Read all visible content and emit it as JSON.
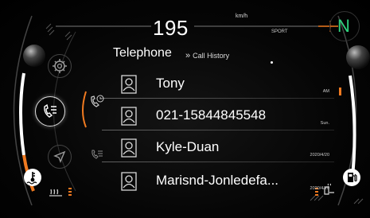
{
  "header": {
    "speed": "195",
    "speed_unit": "km/h",
    "drive_mode": "SPORT",
    "gear": "N"
  },
  "page": {
    "title": "Telephone",
    "breadcrumb": "Call History"
  },
  "calls": [
    {
      "name": "Tony",
      "meta": "AM"
    },
    {
      "name": "021-15844845548",
      "meta": "Sun."
    },
    {
      "name": "Kyle-Duan",
      "meta": "2020/4/20"
    },
    {
      "name": "Marisnd-Jonledefa...",
      "meta": "2020/4/20"
    }
  ],
  "colors": {
    "accent_orange": "#f07a20",
    "gear_green": "#2fd37e"
  },
  "icons": {
    "nav_menu": [
      "settings-gear-icon",
      "phone-list-icon",
      "navigation-arrow-icon"
    ],
    "call_type": "phone-history-icon",
    "contact": "contact-card-icon",
    "left_status": [
      "coolant-temp-icon",
      "seat-heater-icon"
    ],
    "right_status": [
      "fuel-pump-icon",
      "seat-heat-icon"
    ]
  }
}
